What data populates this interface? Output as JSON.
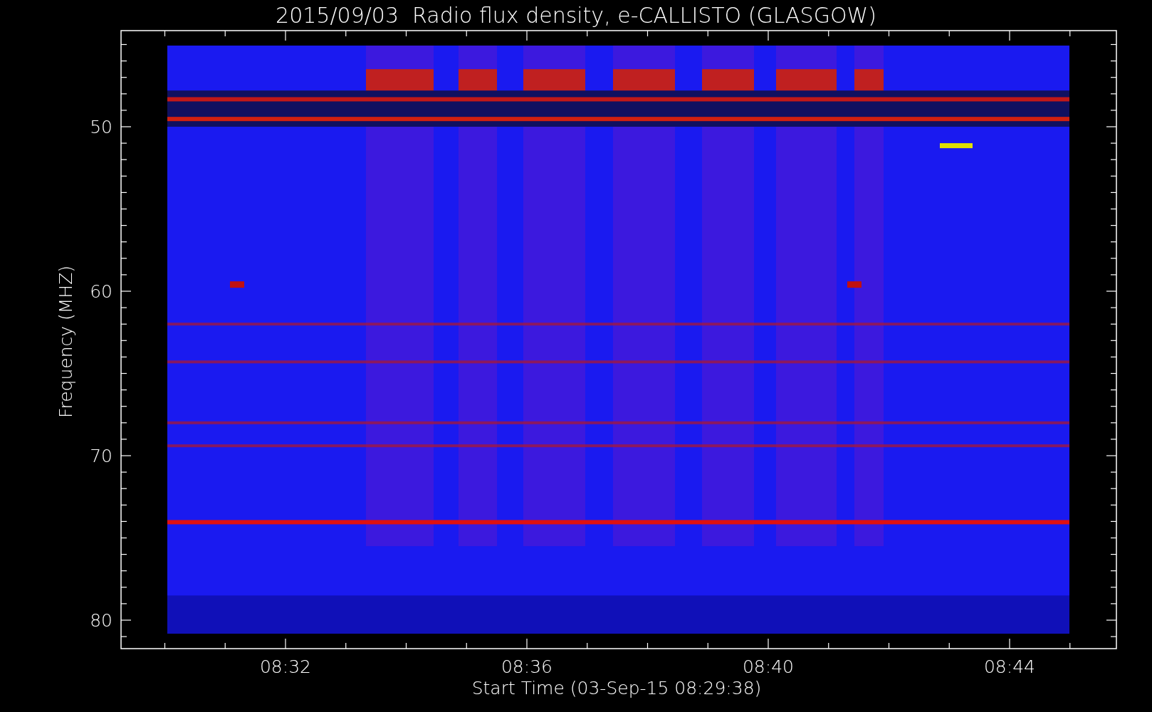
{
  "title": "2015/09/03  Radio flux density, e-CALLISTO (GLASGOW)",
  "plot": {
    "ylabel": "Frequency (MHZ)",
    "xlabel": "Start Time (03-Sep-15 08:29:38)",
    "yticks": [
      "50",
      "60",
      "70",
      "80"
    ],
    "xticks": [
      "08:32",
      "08:36",
      "08:40",
      "08:44"
    ]
  }
}
